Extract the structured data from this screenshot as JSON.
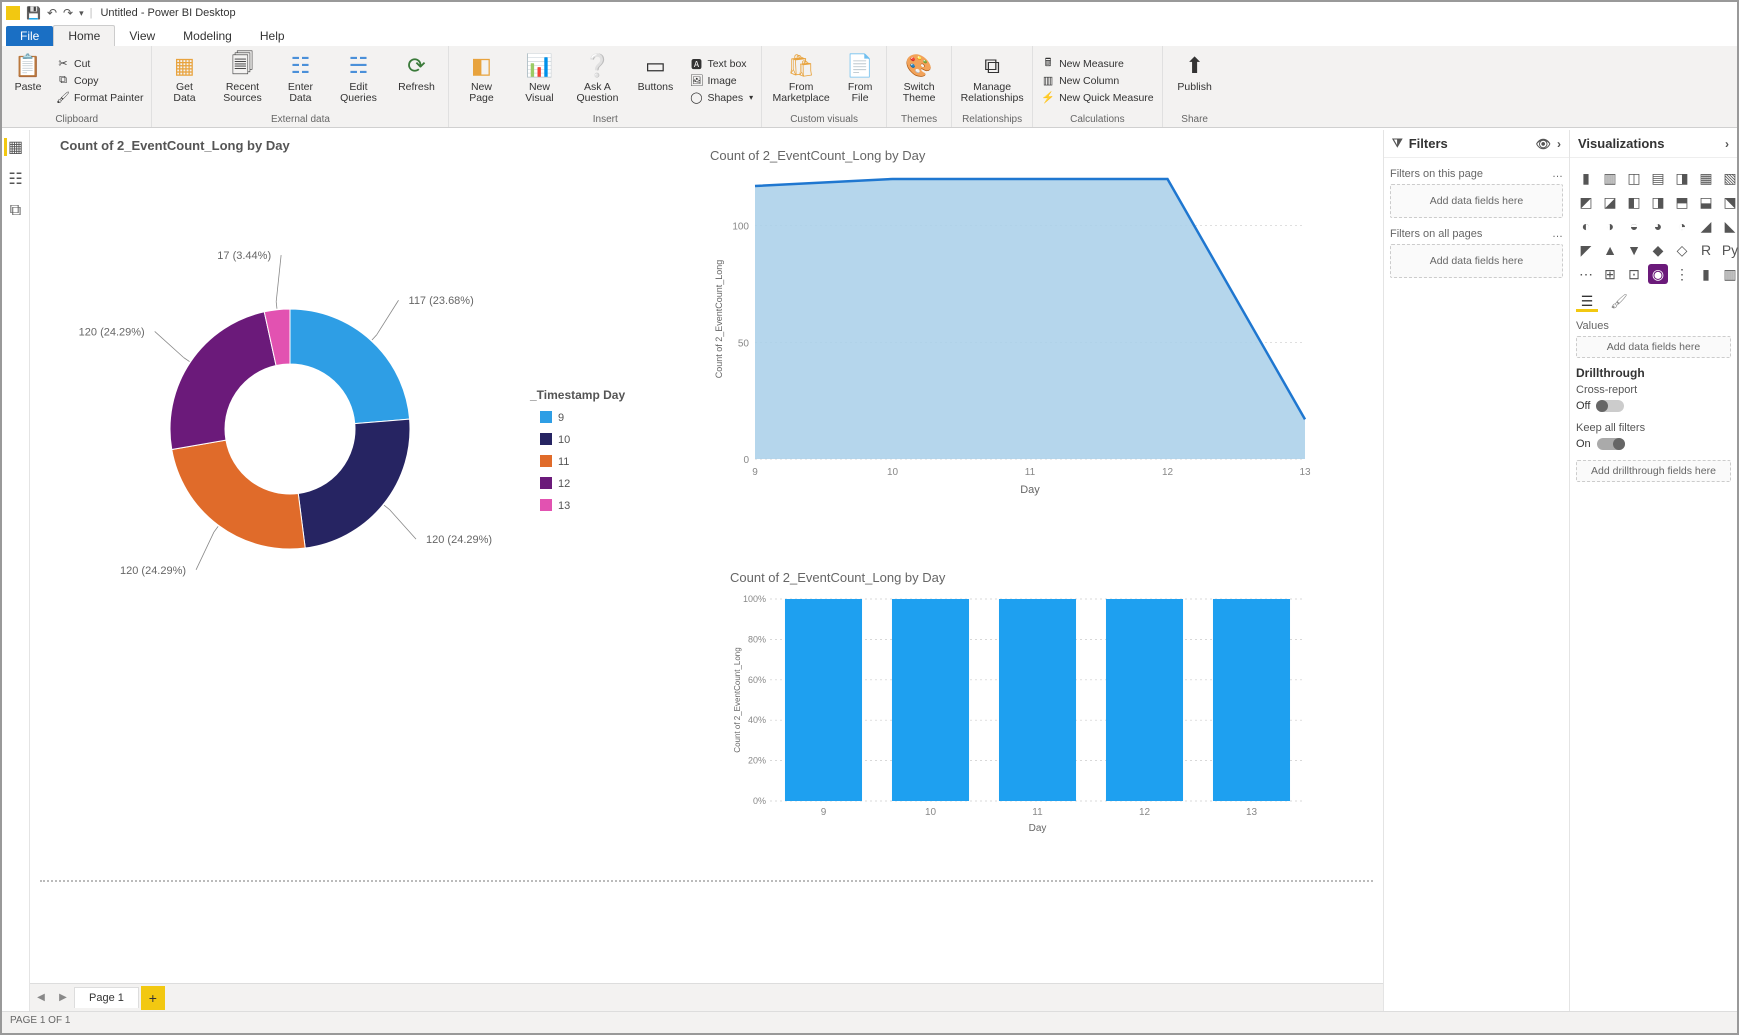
{
  "title": "Untitled - Power BI Desktop",
  "menutabs": {
    "file": "File",
    "home": "Home",
    "view": "View",
    "modeling": "Modeling",
    "help": "Help"
  },
  "ribbon": {
    "clipboard": {
      "label": "Clipboard",
      "paste": "Paste",
      "cut": "Cut",
      "copy": "Copy",
      "fmt": "Format Painter"
    },
    "external": {
      "label": "External data",
      "get": "Get\nData",
      "recent": "Recent\nSources",
      "enter": "Enter\nData",
      "edit": "Edit\nQueries",
      "refresh": "Refresh"
    },
    "insert": {
      "label": "Insert",
      "newpage": "New\nPage",
      "newvisual": "New\nVisual",
      "ask": "Ask A\nQuestion",
      "buttons": "Buttons",
      "textbox": "Text box",
      "image": "Image",
      "shapes": "Shapes"
    },
    "custom": {
      "label": "Custom visuals",
      "market": "From\nMarketplace",
      "file": "From\nFile"
    },
    "themes": {
      "label": "Themes",
      "switch": "Switch\nTheme"
    },
    "rel": {
      "label": "Relationships",
      "manage": "Manage\nRelationships"
    },
    "calc": {
      "label": "Calculations",
      "measure": "New Measure",
      "column": "New Column",
      "quick": "New Quick Measure"
    },
    "share": {
      "label": "Share",
      "publish": "Publish"
    }
  },
  "filters": {
    "title": "Filters",
    "page": "Filters on this page",
    "all": "Filters on all pages",
    "drop": "Add data fields here"
  },
  "viz": {
    "title": "Visualizations",
    "values": "Values",
    "dropfields": "Add data fields here",
    "drill": "Drillthrough",
    "cross": "Cross-report",
    "off": "Off",
    "keep": "Keep all filters",
    "on": "On",
    "dropdrill": "Add drillthrough fields here"
  },
  "page": {
    "tab": "Page 1",
    "status": "PAGE 1 OF 1"
  },
  "charts": {
    "donut": {
      "title": "Count of 2_EventCount_Long by Day",
      "legend_title": "_Timestamp Day"
    },
    "area": {
      "title": "Count of 2_EventCount_Long by Day",
      "ylabel": "Count of 2_EventCount_Long",
      "xlabel": "Day"
    },
    "bar": {
      "title": "Count of 2_EventCount_Long by Day",
      "ylabel": "Count of 2_EventCount_Long",
      "xlabel": "Day"
    }
  },
  "chart_data": [
    {
      "id": "donut",
      "type": "pie",
      "title": "Count of 2_EventCount_Long by Day",
      "series": [
        {
          "name": "_Timestamp Day",
          "values": [
            {
              "cat": "9",
              "value": 117,
              "pct": 23.68,
              "color": "#2e9ee5",
              "label": "117 (23.68%)"
            },
            {
              "cat": "10",
              "value": 120,
              "pct": 24.29,
              "color": "#262462",
              "label": "120 (24.29%)"
            },
            {
              "cat": "11",
              "value": 120,
              "pct": 24.29,
              "color": "#e06b2a",
              "label": "120 (24.29%)"
            },
            {
              "cat": "12",
              "value": 120,
              "pct": 24.29,
              "color": "#6b1a7a",
              "label": "120 (24.29%)"
            },
            {
              "cat": "13",
              "value": 17,
              "pct": 3.44,
              "color": "#e252b1",
              "label": "17 (3.44%)"
            }
          ]
        }
      ]
    },
    {
      "id": "area",
      "type": "area",
      "title": "Count of 2_EventCount_Long by Day",
      "xlabel": "Day",
      "ylabel": "Count of 2_EventCount_Long",
      "x": [
        9,
        10,
        11,
        12,
        13
      ],
      "values": [
        117,
        120,
        120,
        120,
        17
      ],
      "ylim": [
        0,
        120
      ],
      "yticks": [
        0,
        50,
        100
      ],
      "color_line": "#1f77d0",
      "color_fill": "#a8cfe9"
    },
    {
      "id": "bar",
      "type": "bar",
      "title": "Count of 2_EventCount_Long by Day",
      "xlabel": "Day",
      "ylabel": "Count of 2_EventCount_Long",
      "categories": [
        "9",
        "10",
        "11",
        "12",
        "13"
      ],
      "values": [
        100,
        100,
        100,
        100,
        100
      ],
      "unit": "%",
      "ylim": [
        0,
        100
      ],
      "yticks": [
        0,
        20,
        40,
        60,
        80,
        100
      ],
      "color": "#1ea0f0"
    }
  ]
}
